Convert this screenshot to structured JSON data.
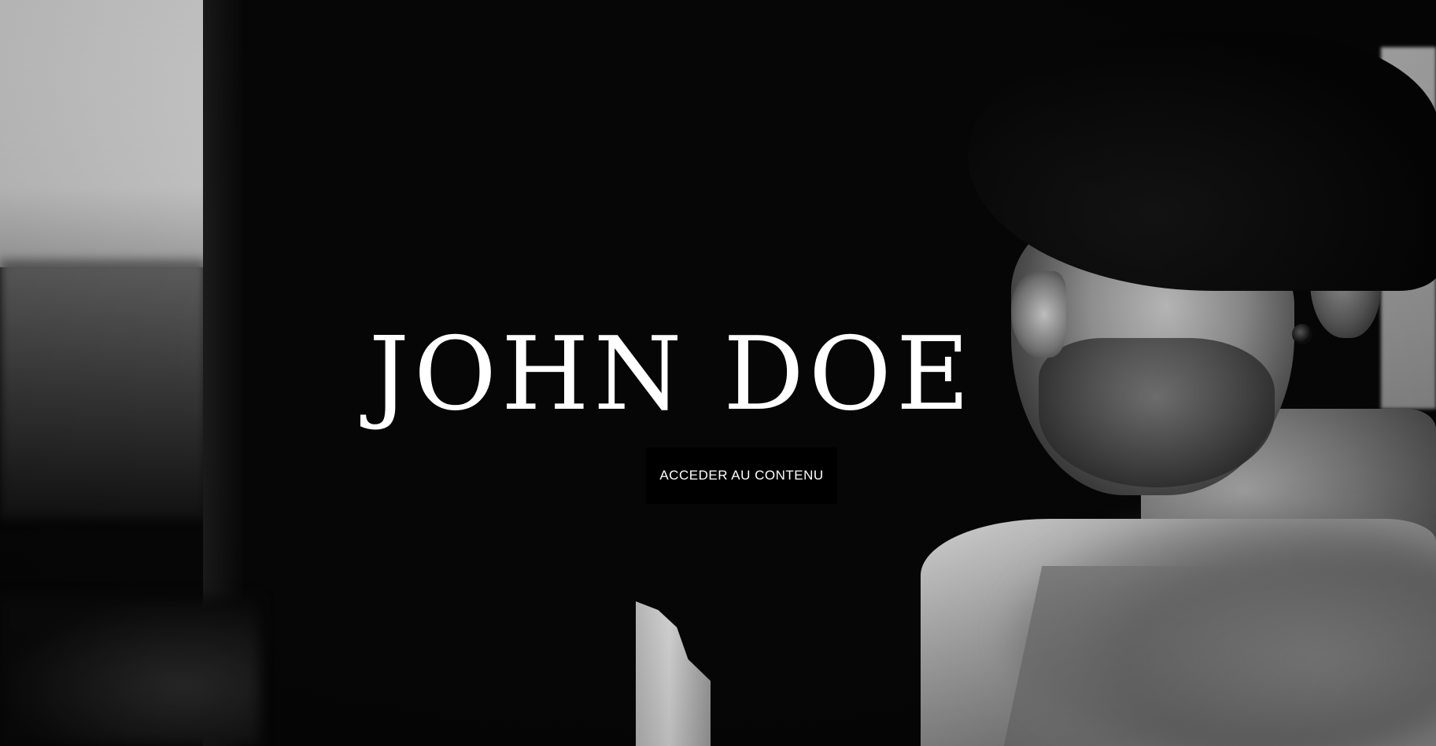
{
  "hero": {
    "title": "JOHN DOE",
    "cta_label": "ACCEDER AU CONTENU",
    "background_image": "black-and-white-portrait-man-cap",
    "colors": {
      "title": "#ffffff",
      "button_bg": "#000000",
      "button_text": "#ffffff"
    }
  }
}
